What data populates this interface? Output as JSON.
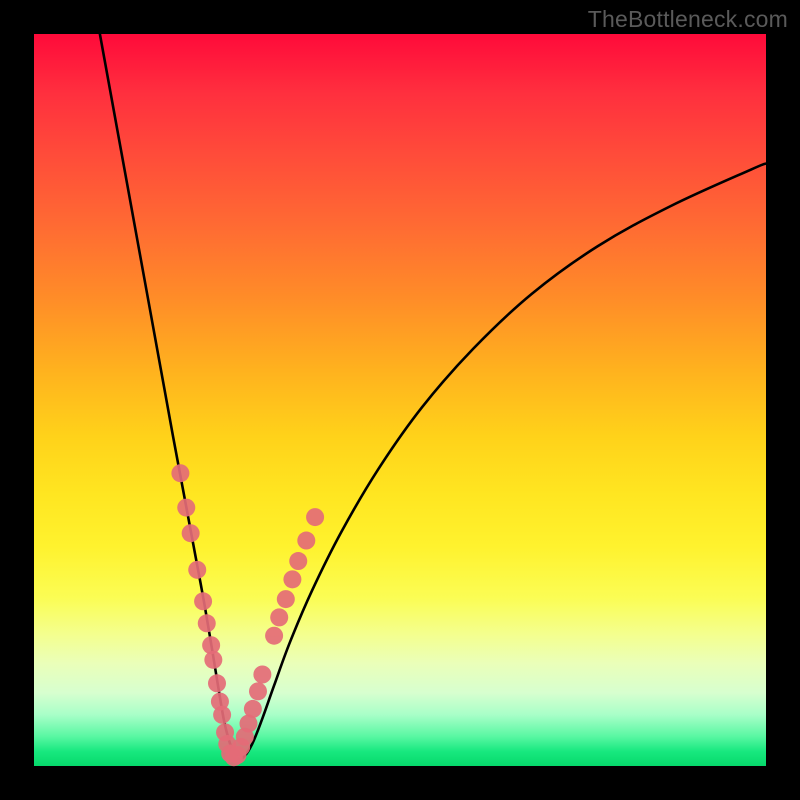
{
  "watermark": "TheBottleneck.com",
  "chart_data": {
    "type": "line",
    "title": "",
    "xlabel": "",
    "ylabel": "",
    "xlim": [
      0,
      100
    ],
    "ylim": [
      0,
      100
    ],
    "grid": false,
    "curve": {
      "x": [
        9,
        11,
        13,
        15,
        17,
        19,
        20.5,
        22,
        23.3,
        24.4,
        25.3,
        26,
        26.8,
        27.6,
        28.6,
        29.8,
        31.2,
        32.8,
        35,
        38,
        42,
        47,
        53,
        60,
        68,
        77,
        87,
        98,
        100
      ],
      "y": [
        100,
        89,
        78,
        67,
        56,
        45,
        37,
        29,
        22,
        15.5,
        10,
        6,
        3,
        1.2,
        1.2,
        3,
        6.5,
        11,
        17,
        24,
        32,
        40.5,
        49,
        57,
        64.5,
        71,
        76.5,
        81.5,
        82.3
      ]
    },
    "markers": {
      "color": "#e46b77",
      "radius_px": 9,
      "points": [
        {
          "x": 20.0,
          "y": 40.0
        },
        {
          "x": 20.8,
          "y": 35.3
        },
        {
          "x": 21.4,
          "y": 31.8
        },
        {
          "x": 22.3,
          "y": 26.8
        },
        {
          "x": 23.1,
          "y": 22.5
        },
        {
          "x": 23.6,
          "y": 19.5
        },
        {
          "x": 24.2,
          "y": 16.5
        },
        {
          "x": 24.5,
          "y": 14.5
        },
        {
          "x": 25.0,
          "y": 11.3
        },
        {
          "x": 25.4,
          "y": 8.8
        },
        {
          "x": 25.7,
          "y": 7.0
        },
        {
          "x": 26.1,
          "y": 4.6
        },
        {
          "x": 26.4,
          "y": 3.0
        },
        {
          "x": 26.8,
          "y": 1.7
        },
        {
          "x": 27.3,
          "y": 1.2
        },
        {
          "x": 27.8,
          "y": 1.5
        },
        {
          "x": 28.3,
          "y": 2.6
        },
        {
          "x": 28.8,
          "y": 4.0
        },
        {
          "x": 29.3,
          "y": 5.8
        },
        {
          "x": 29.9,
          "y": 7.8
        },
        {
          "x": 30.6,
          "y": 10.2
        },
        {
          "x": 31.2,
          "y": 12.5
        },
        {
          "x": 32.8,
          "y": 17.8
        },
        {
          "x": 33.5,
          "y": 20.3
        },
        {
          "x": 34.4,
          "y": 22.8
        },
        {
          "x": 35.3,
          "y": 25.5
        },
        {
          "x": 36.1,
          "y": 28.0
        },
        {
          "x": 37.2,
          "y": 30.8
        },
        {
          "x": 38.4,
          "y": 34.0
        }
      ]
    }
  }
}
